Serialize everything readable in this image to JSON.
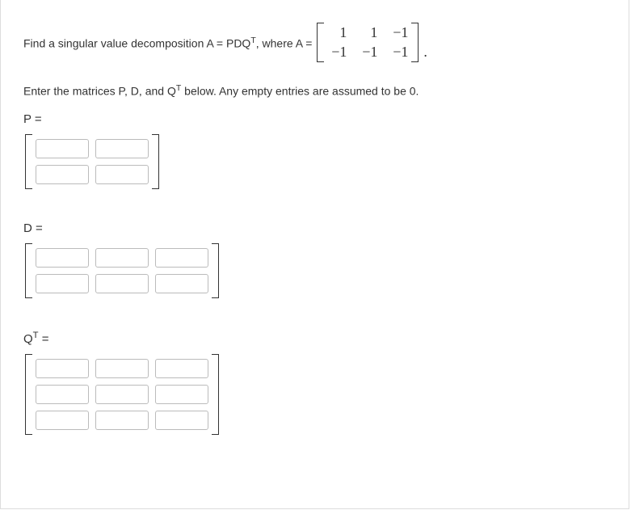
{
  "prompt": {
    "text_before_matrix": "Find a singular value decomposition A = PDQ",
    "sup1": "T",
    "text_after_sup": ", where A =",
    "period": "."
  },
  "instruction": {
    "text1": "Enter the matrices P, D, and Q",
    "sup": "T",
    "text2": " below. Any empty entries are assumed to be 0."
  },
  "A": {
    "rows": [
      [
        "1",
        "1",
        "−1"
      ],
      [
        "−1",
        "−1",
        "−1"
      ]
    ]
  },
  "labels": {
    "P": "P =",
    "D": "D =",
    "QT": "Q",
    "QT_sup": "T",
    "QT_after": " ="
  },
  "inputs": {
    "P": {
      "rows": 2,
      "cols": 2
    },
    "D": {
      "rows": 2,
      "cols": 3
    },
    "QT": {
      "rows": 3,
      "cols": 3
    }
  }
}
